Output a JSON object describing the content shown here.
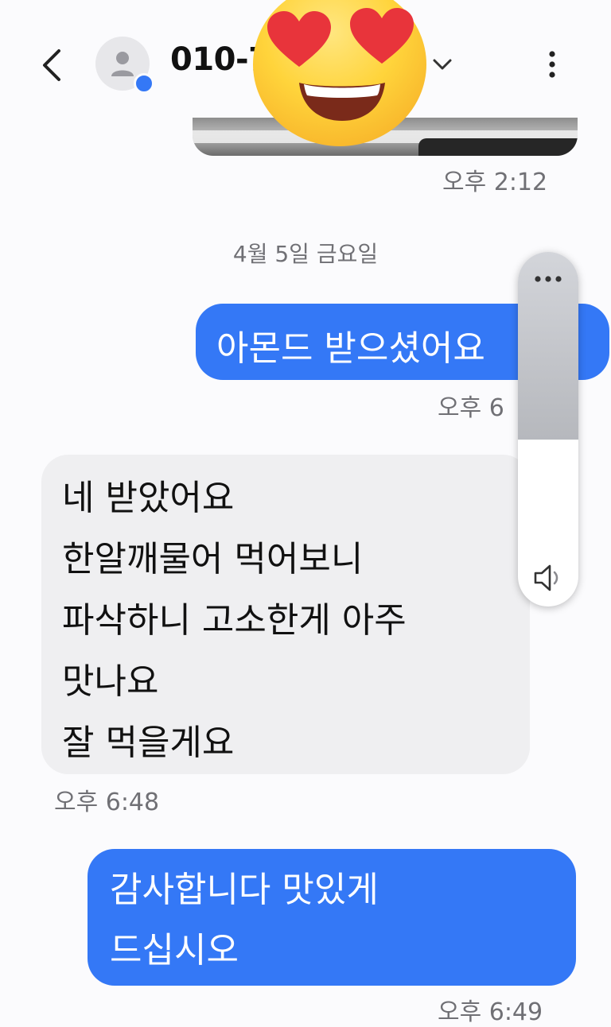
{
  "header": {
    "contact_name": "010-7",
    "back_icon": "chevron-left-icon",
    "dropdown_icon": "chevron-down-icon",
    "more_icon": "more-vert-icon"
  },
  "thread": {
    "photo_time": "오후 2:12",
    "date_separator": "4월 5일 금요일",
    "messages": [
      {
        "direction": "out",
        "text": "아몬드 받으셨어요",
        "time": "오후 6"
      },
      {
        "direction": "in",
        "lines": [
          "네 받았어요",
          "한알깨물어 먹어보니",
          "파삭하니 고소한게 아주",
          "맛나요",
          "잘 먹을게요"
        ],
        "time": "오후 6:48"
      },
      {
        "direction": "out",
        "lines": [
          "감사합니다 맛있게",
          "드십시오"
        ],
        "time": "오후 6:49"
      }
    ]
  },
  "volume_panel": {
    "level": 0.53,
    "more_icon": "more-horiz-icon",
    "speaker_icon": "speaker-icon"
  },
  "overlay": {
    "emoji": "heart-eyes-emoji"
  },
  "colors": {
    "accent": "#3478f6",
    "incoming": "#efeff1"
  }
}
